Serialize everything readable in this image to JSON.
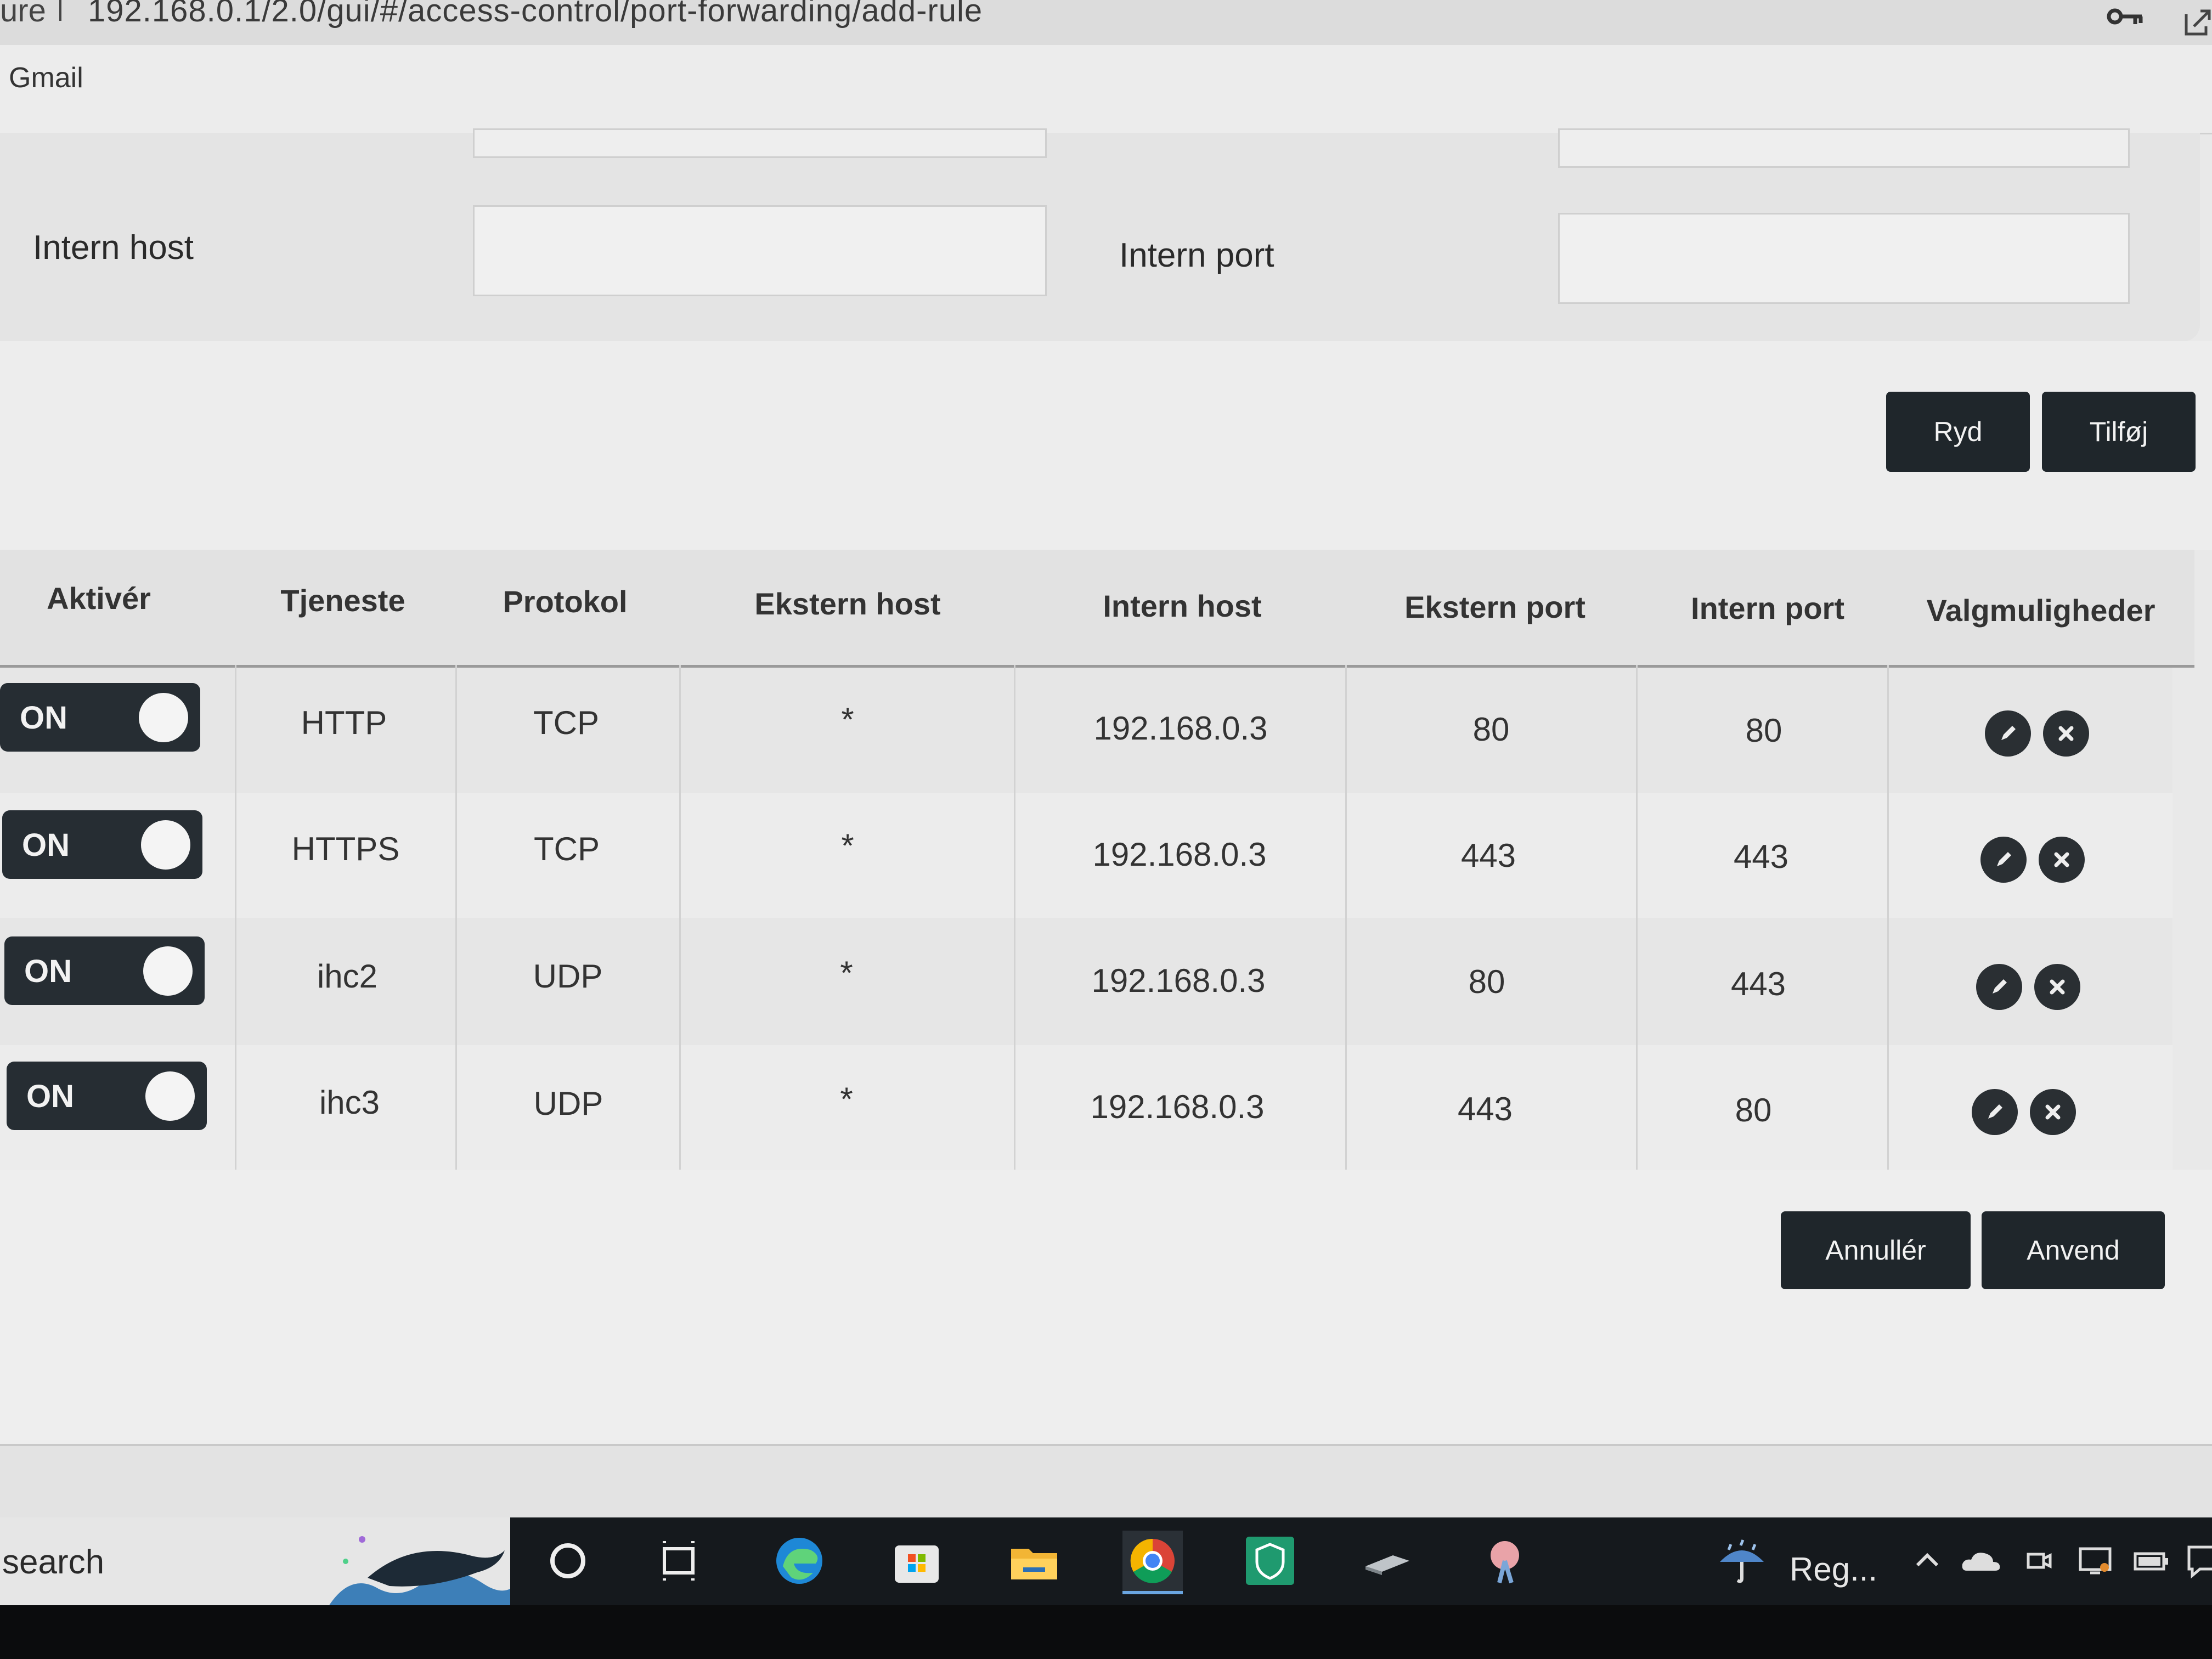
{
  "browser": {
    "address_prefix": "ure",
    "address_url": "192.168.0.1/2.0/gui/#/access-control/port-forwarding/add-rule",
    "bookmark": "Gmail"
  },
  "form": {
    "intern_host_label": "Intern host",
    "intern_host_value": "",
    "intern_port_label": "Intern port",
    "intern_port_value": "",
    "clear_button": "Ryd",
    "add_button": "Tilføj"
  },
  "table": {
    "headers": [
      "Aktivér",
      "Tjeneste",
      "Protokol",
      "Ekstern host",
      "Intern host",
      "Ekstern port",
      "Intern port",
      "Valgmuligheder"
    ],
    "rows": [
      {
        "toggle": "ON",
        "service": "HTTP",
        "protocol": "TCP",
        "ext_host": "*",
        "int_host": "192.168.0.3",
        "ext_port": "80",
        "int_port": "80"
      },
      {
        "toggle": "ON",
        "service": "HTTPS",
        "protocol": "TCP",
        "ext_host": "*",
        "int_host": "192.168.0.3",
        "ext_port": "443",
        "int_port": "443"
      },
      {
        "toggle": "ON",
        "service": "ihc2",
        "protocol": "UDP",
        "ext_host": "*",
        "int_host": "192.168.0.3",
        "ext_port": "80",
        "int_port": "443"
      },
      {
        "toggle": "ON",
        "service": "ihc3",
        "protocol": "UDP",
        "ext_host": "*",
        "int_host": "192.168.0.3",
        "ext_port": "443",
        "int_port": "80"
      }
    ],
    "row_icons": [
      "edit-icon",
      "delete-icon"
    ]
  },
  "actions": {
    "cancel_button": "Annullér",
    "apply_button": "Anvend"
  },
  "taskbar": {
    "search": "search",
    "tray_weather": "Reg...",
    "icons": [
      "cortana-icon",
      "task-view-icon",
      "edge-icon",
      "store-icon",
      "file-explorer-icon",
      "chrome-icon",
      "security-shield-icon",
      "app-icon",
      "snipping-icon"
    ]
  },
  "colors": {
    "button_dark": "#1f262b",
    "toggle_dark": "#262d33",
    "taskbar": "#15191d"
  }
}
